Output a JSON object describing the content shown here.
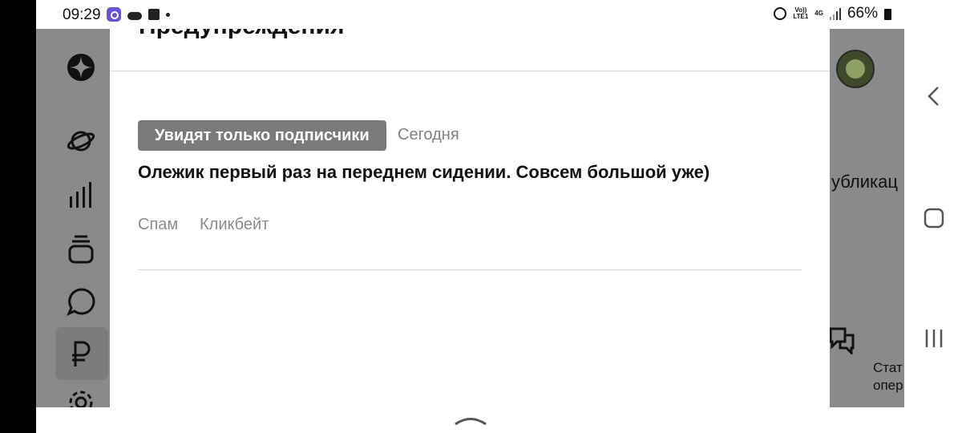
{
  "status_bar": {
    "time": "09:29",
    "network_top": "Vo))",
    "network_bottom": "LTE1",
    "network_type": "4G",
    "battery": "66%"
  },
  "background_app": {
    "publications_fragment": "убликац",
    "stats_fragment_line1": "Стат",
    "stats_fragment_line2": "опер",
    "sidebar_icons": [
      "star-logo-icon",
      "planet-icon",
      "bar-chart-icon",
      "stack-icon",
      "chat-bubble-icon",
      "ruble-icon",
      "settings-gear-icon"
    ]
  },
  "modal": {
    "title": "Предупреждения",
    "warning": {
      "badge": "Увидят только подписчики",
      "date": "Сегодня",
      "text": "Олежик первый раз на переднем сидении. Совсем большой уже)",
      "reasons": [
        "Спам",
        "Кликбейт"
      ]
    }
  },
  "colors": {
    "overlay": "#8a8a8a",
    "badge_bg": "#7a7a7a",
    "muted_text": "#808080"
  }
}
